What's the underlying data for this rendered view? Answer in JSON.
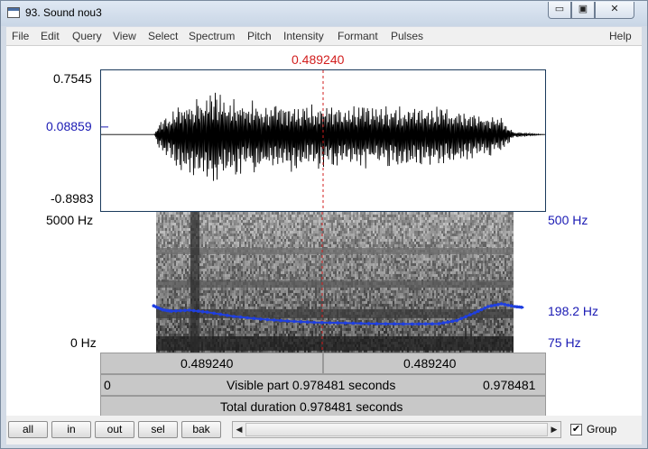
{
  "window": {
    "title": "93. Sound nou3"
  },
  "window_controls": {
    "minimize": "▭",
    "maximize": "▣",
    "close": "✕"
  },
  "menu": [
    "File",
    "Edit",
    "Query",
    "View",
    "Select",
    "Spectrum",
    "Pitch",
    "Intensity",
    "Formant",
    "Pulses"
  ],
  "help": "Help",
  "cursor": {
    "time": "0.489240",
    "fraction": 0.5
  },
  "waveform": {
    "max_label": "0.7545",
    "cursor_value_label": "0.08859",
    "min_label": "-0.8983",
    "max": 0.7545,
    "min": -0.8983,
    "cursor_value": 0.08859,
    "amplitude_envelope": [
      [
        0.0,
        0
      ],
      [
        0.12,
        0
      ],
      [
        0.13,
        0.3
      ],
      [
        0.17,
        0.55
      ],
      [
        0.2,
        0.75
      ],
      [
        0.25,
        0.92
      ],
      [
        0.28,
        0.75
      ],
      [
        0.33,
        0.7
      ],
      [
        0.45,
        0.62
      ],
      [
        0.6,
        0.58
      ],
      [
        0.8,
        0.56
      ],
      [
        0.82,
        0.45
      ],
      [
        0.9,
        0.35
      ],
      [
        0.93,
        0.05
      ],
      [
        1.0,
        0
      ]
    ]
  },
  "spectrogram": {
    "top_label": "5000 Hz",
    "bottom_label": "0 Hz",
    "pitch_top_label": "500 Hz",
    "pitch_cursor_label": "198.2 Hz",
    "pitch_bottom_label": "75 Hz",
    "pitch_range_hz": [
      75,
      500
    ],
    "pitch_points": [
      [
        0.12,
        216
      ],
      [
        0.14,
        204
      ],
      [
        0.16,
        200
      ],
      [
        0.2,
        203
      ],
      [
        0.24,
        197
      ],
      [
        0.3,
        184
      ],
      [
        0.36,
        176
      ],
      [
        0.42,
        170
      ],
      [
        0.48,
        166
      ],
      [
        0.55,
        164
      ],
      [
        0.62,
        162
      ],
      [
        0.7,
        161
      ],
      [
        0.76,
        162
      ],
      [
        0.8,
        172
      ],
      [
        0.84,
        195
      ],
      [
        0.87,
        214
      ],
      [
        0.9,
        222
      ],
      [
        0.93,
        214
      ],
      [
        0.95,
        211
      ]
    ]
  },
  "time_bar": {
    "left": "0.489240",
    "right": "0.489240"
  },
  "visible_bar": {
    "start": "0",
    "label": "Visible part 0.978481 seconds",
    "end": "0.978481"
  },
  "total_bar": {
    "label": "Total duration 0.978481 seconds"
  },
  "buttons": {
    "all": "all",
    "in": "in",
    "out": "out",
    "sel": "sel",
    "bak": "bak"
  },
  "scroll": {
    "left_arrow": "◀",
    "right_arrow": "▶"
  },
  "group": {
    "checked": "✔",
    "label": "Group"
  },
  "colors": {
    "cursor": "#d21e1e",
    "axis_blue": "#1a1ab4",
    "pitch": "#1f3fe0",
    "frame": "#1b3a5c"
  }
}
